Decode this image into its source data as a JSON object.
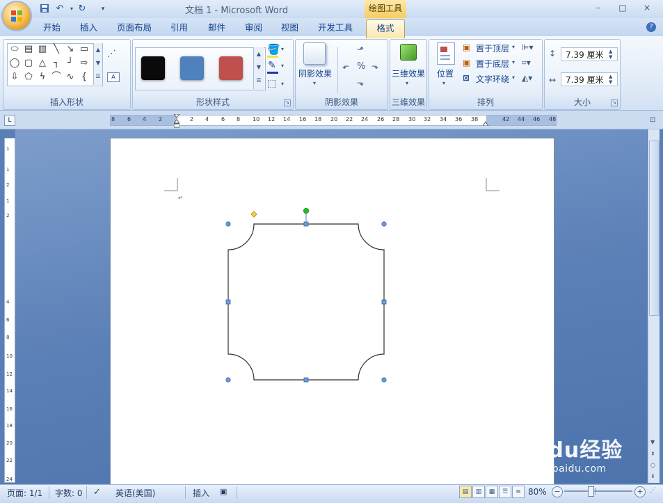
{
  "app": {
    "title": "文档 1 - Microsoft Word",
    "context_tab": "绘图工具"
  },
  "quick_access": [
    "save-icon",
    "undo-icon",
    "redo-icon",
    "customize-icon"
  ],
  "window": {
    "minimize": "–",
    "maximize": "□",
    "close": "×"
  },
  "tabs": [
    "开始",
    "插入",
    "页面布局",
    "引用",
    "邮件",
    "审阅",
    "视图",
    "开发工具",
    "格式"
  ],
  "active_tab": "格式",
  "ribbon": {
    "insert_shapes": {
      "label": "插入形状"
    },
    "shape_styles": {
      "label": "形状样式",
      "swatches": [
        "#0a0a0a",
        "#4f81bd",
        "#c0504d"
      ]
    },
    "shadow": {
      "button": "阴影效果",
      "label": "阴影效果"
    },
    "three_d": {
      "button": "三维效果",
      "label": "三维效果"
    },
    "arrange": {
      "position": "位置",
      "bring_front": "置于顶层",
      "send_back": "置于底层",
      "text_wrap": "文字环绕",
      "label": "排列"
    },
    "size": {
      "height": "7.39 厘米",
      "width": "7.39 厘米",
      "label": "大小"
    }
  },
  "ruler": {
    "h_ticks": [
      "8",
      "6",
      "4",
      "2",
      "2",
      "4",
      "6",
      "8",
      "10",
      "12",
      "14",
      "16",
      "18",
      "20",
      "22",
      "24",
      "26",
      "28",
      "30",
      "32",
      "34",
      "36",
      "38",
      "42",
      "44",
      "46",
      "48"
    ],
    "v_ticks": [
      "1",
      "1",
      "2",
      "1",
      "2",
      "4",
      "6",
      "8",
      "10",
      "12",
      "14",
      "16",
      "18",
      "20",
      "22",
      "24"
    ]
  },
  "status": {
    "page": "页面: 1/1",
    "words": "字数: 0",
    "language": "英语(美国)",
    "mode": "插入",
    "zoom": "80%"
  },
  "watermark": {
    "text": "Baidu经验",
    "url": "jingyan.baidu.com"
  },
  "colors": {
    "accent": "#15428b",
    "handle": "#4f81bd",
    "rotate": "#22c322",
    "adjust": "#f6d24a"
  }
}
